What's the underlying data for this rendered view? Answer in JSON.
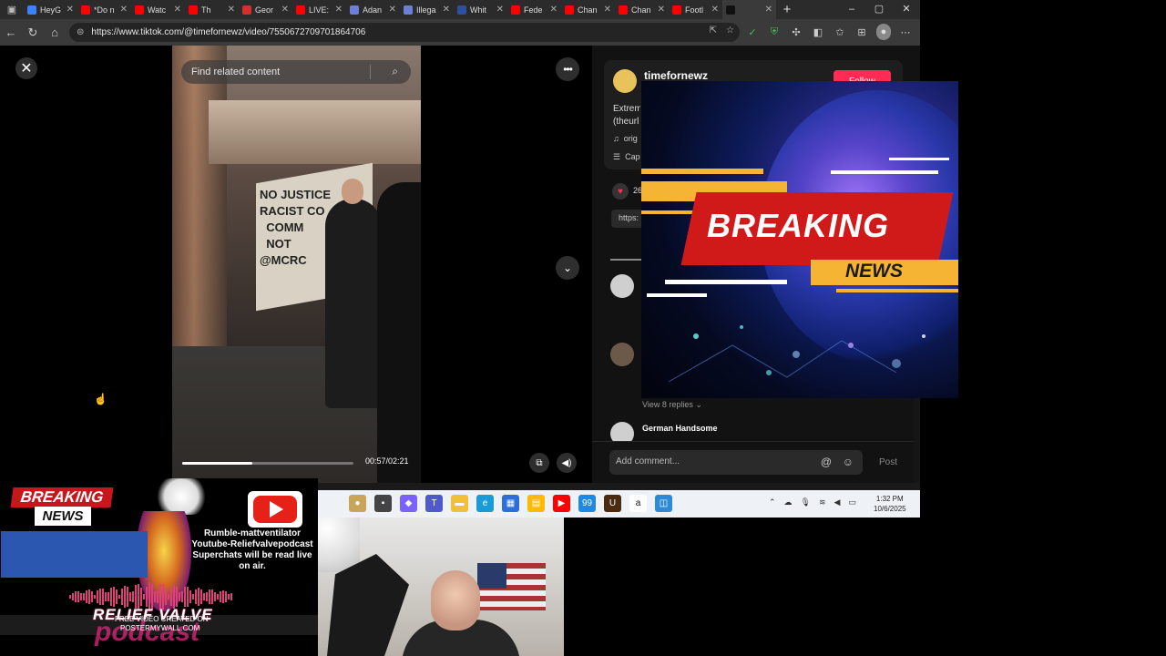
{
  "browser": {
    "tabs": [
      {
        "label": "HeyG",
        "color": "#3b82f6"
      },
      {
        "label": "*Do n",
        "color": "#ff0000"
      },
      {
        "label": "Watc",
        "color": "#ff0000"
      },
      {
        "label": "Th",
        "color": "#ff0000"
      },
      {
        "label": "Geor",
        "color": "#d32f2f"
      },
      {
        "label": "LIVE:",
        "color": "#ff0000"
      },
      {
        "label": "Adan",
        "color": "#6b7fd7"
      },
      {
        "label": "Illega",
        "color": "#6b7fd7"
      },
      {
        "label": "Whit",
        "color": "#2d4f9e"
      },
      {
        "label": "Fede",
        "color": "#ff0000"
      },
      {
        "label": "Chan",
        "color": "#ff0000"
      },
      {
        "label": "Chan",
        "color": "#ff0000"
      },
      {
        "label": "Footl",
        "color": "#ff0000"
      },
      {
        "label": "",
        "color": "#111111"
      }
    ],
    "url": "https://www.tiktok.com/@timefornewz/video/7550672709701864706"
  },
  "tiktok": {
    "search_placeholder": "Find related content",
    "video_time": "00:57/02:21",
    "progress_fraction": 0.41,
    "username": "timefornewz",
    "follow_label": "Follow",
    "description_line1": "Extrem",
    "description_line2": "(theurl",
    "music": "orig",
    "caption": "Cap",
    "like_count": "26",
    "link": "https:",
    "view_replies": "View 8 replies",
    "comment_author": "German Handsome",
    "comment_placeholder": "Add comment...",
    "post_label": "Post"
  },
  "video_banner_text": "NO JUSTICE FROM A RACIST CO... COMM NOT @MCRC",
  "taskbar": {
    "time": "1:32 PM",
    "date": "10/6/2025",
    "badge": "99"
  },
  "overlay": {
    "breaking": "BREAKING",
    "news": "NEWS"
  },
  "stream_logo": {
    "breaking": "BREAKING",
    "news": "NEWS",
    "promo_line1": "Rumble-mattventilator",
    "promo_line2": "Youtube-Reliefvalvepodcast",
    "promo_line3": "Superchats will be read live on air.",
    "brand": "RELIEF VALVE",
    "brand2": "podcast",
    "credit_line1": "FREE VIDEO CREATED ON",
    "credit_line2": "POSTERMYWALL.COM"
  },
  "colors": {
    "tiktok_red": "#fe2c55",
    "breaking_red": "#d01a1a",
    "news_yellow": "#f5b433"
  }
}
